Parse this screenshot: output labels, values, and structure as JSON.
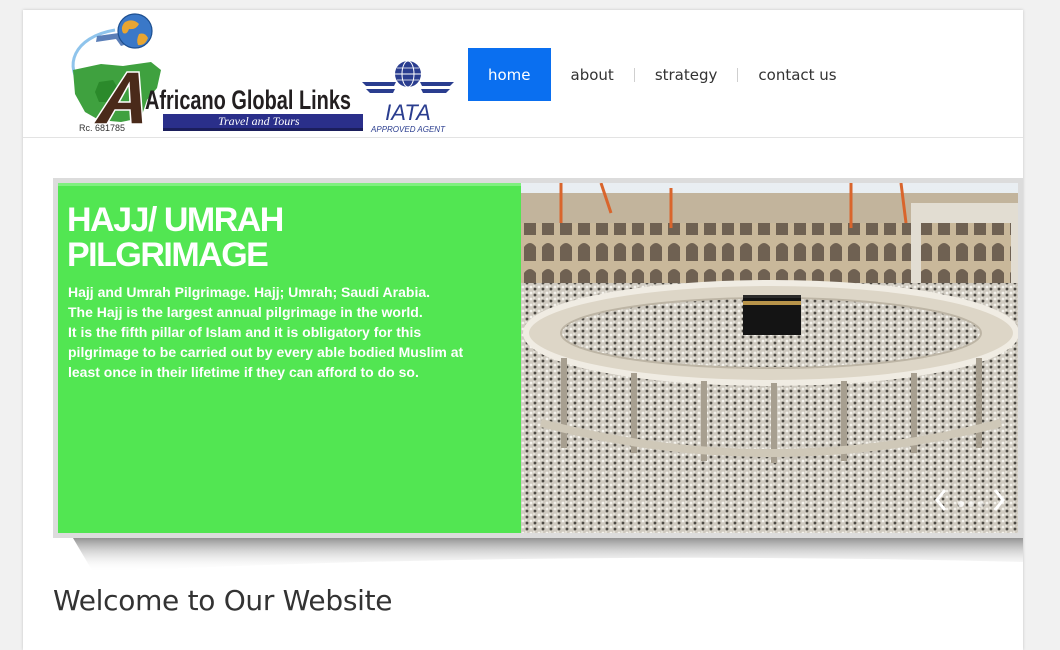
{
  "brand": {
    "name": "Africano Global Links",
    "tagline": "Travel and Tours",
    "rc_number": "Rc. 681785",
    "iata_text": "IATA",
    "iata_subtext": "APPROVED AGENT"
  },
  "nav": {
    "items": [
      {
        "label": "home",
        "active": true
      },
      {
        "label": "about",
        "active": false
      },
      {
        "label": "strategy",
        "active": false
      },
      {
        "label": "contact us",
        "active": false
      }
    ]
  },
  "slider": {
    "title_line1": "HAJJ/ UMRAH",
    "title_line2": "PILGRIMAGE",
    "body_lines": [
      "Hajj and Umrah Pilgrimage. Hajj; Umrah; Saudi Arabia.",
      "The Hajj is the largest annual pilgrimage in the world.",
      "It is the fifth pillar of Islam and it is obligatory for this",
      "pilgrimage to be carried out by every able bodied Muslim at",
      "least once in their lifetime if they can afford to do so."
    ],
    "panel_color": "#52e652"
  },
  "main": {
    "heading": "Welcome to Our Website"
  },
  "colors": {
    "nav_active": "#0a6ff0",
    "logo_blue": "#2a2f8a",
    "logo_green": "#2e9e2e"
  }
}
